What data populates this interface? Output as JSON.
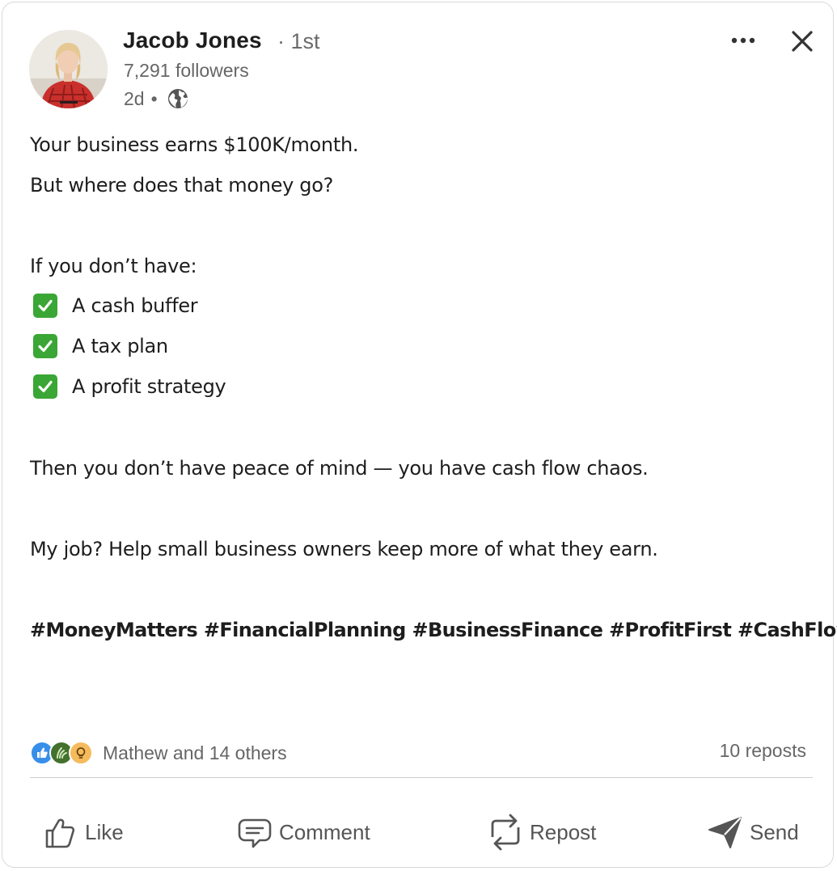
{
  "author": {
    "name": "Jacob Jones",
    "degree": "1st",
    "followers": "7,291 followers",
    "time": "2d",
    "visibility_icon": "globe-icon"
  },
  "header_controls": {
    "more_icon": "more-horizontal-icon",
    "close_icon": "close-icon"
  },
  "post": {
    "line1": "Your business earns $100K/month.",
    "line2": "But where does that money go?",
    "line3": "If you don’t have:",
    "checklist": [
      "A cash buffer",
      "A tax plan",
      "A profit strategy"
    ],
    "line4": "Then you don’t have peace of mind — you have cash flow chaos.",
    "line5": "My job? Help small business owners keep more of what they earn.",
    "hashtags": "#MoneyMatters #FinancialPlanning #BusinessFinance #ProfitFirst #CashFlow"
  },
  "social": {
    "reactions": [
      "like-reaction-icon",
      "celebrate-reaction-icon",
      "insightful-reaction-icon"
    ],
    "reactors": "Mathew and 14 others",
    "reposts": "10 reposts"
  },
  "actions": {
    "like": "Like",
    "comment": "Comment",
    "repost": "Repost",
    "send": "Send"
  },
  "colors": {
    "text": "#1d1d1d",
    "muted": "#666666",
    "check_green": "#3aa635",
    "like_blue": "#378fe9",
    "celebrate_green": "#44712e",
    "insightful_yellow": "#f5bb5c"
  }
}
